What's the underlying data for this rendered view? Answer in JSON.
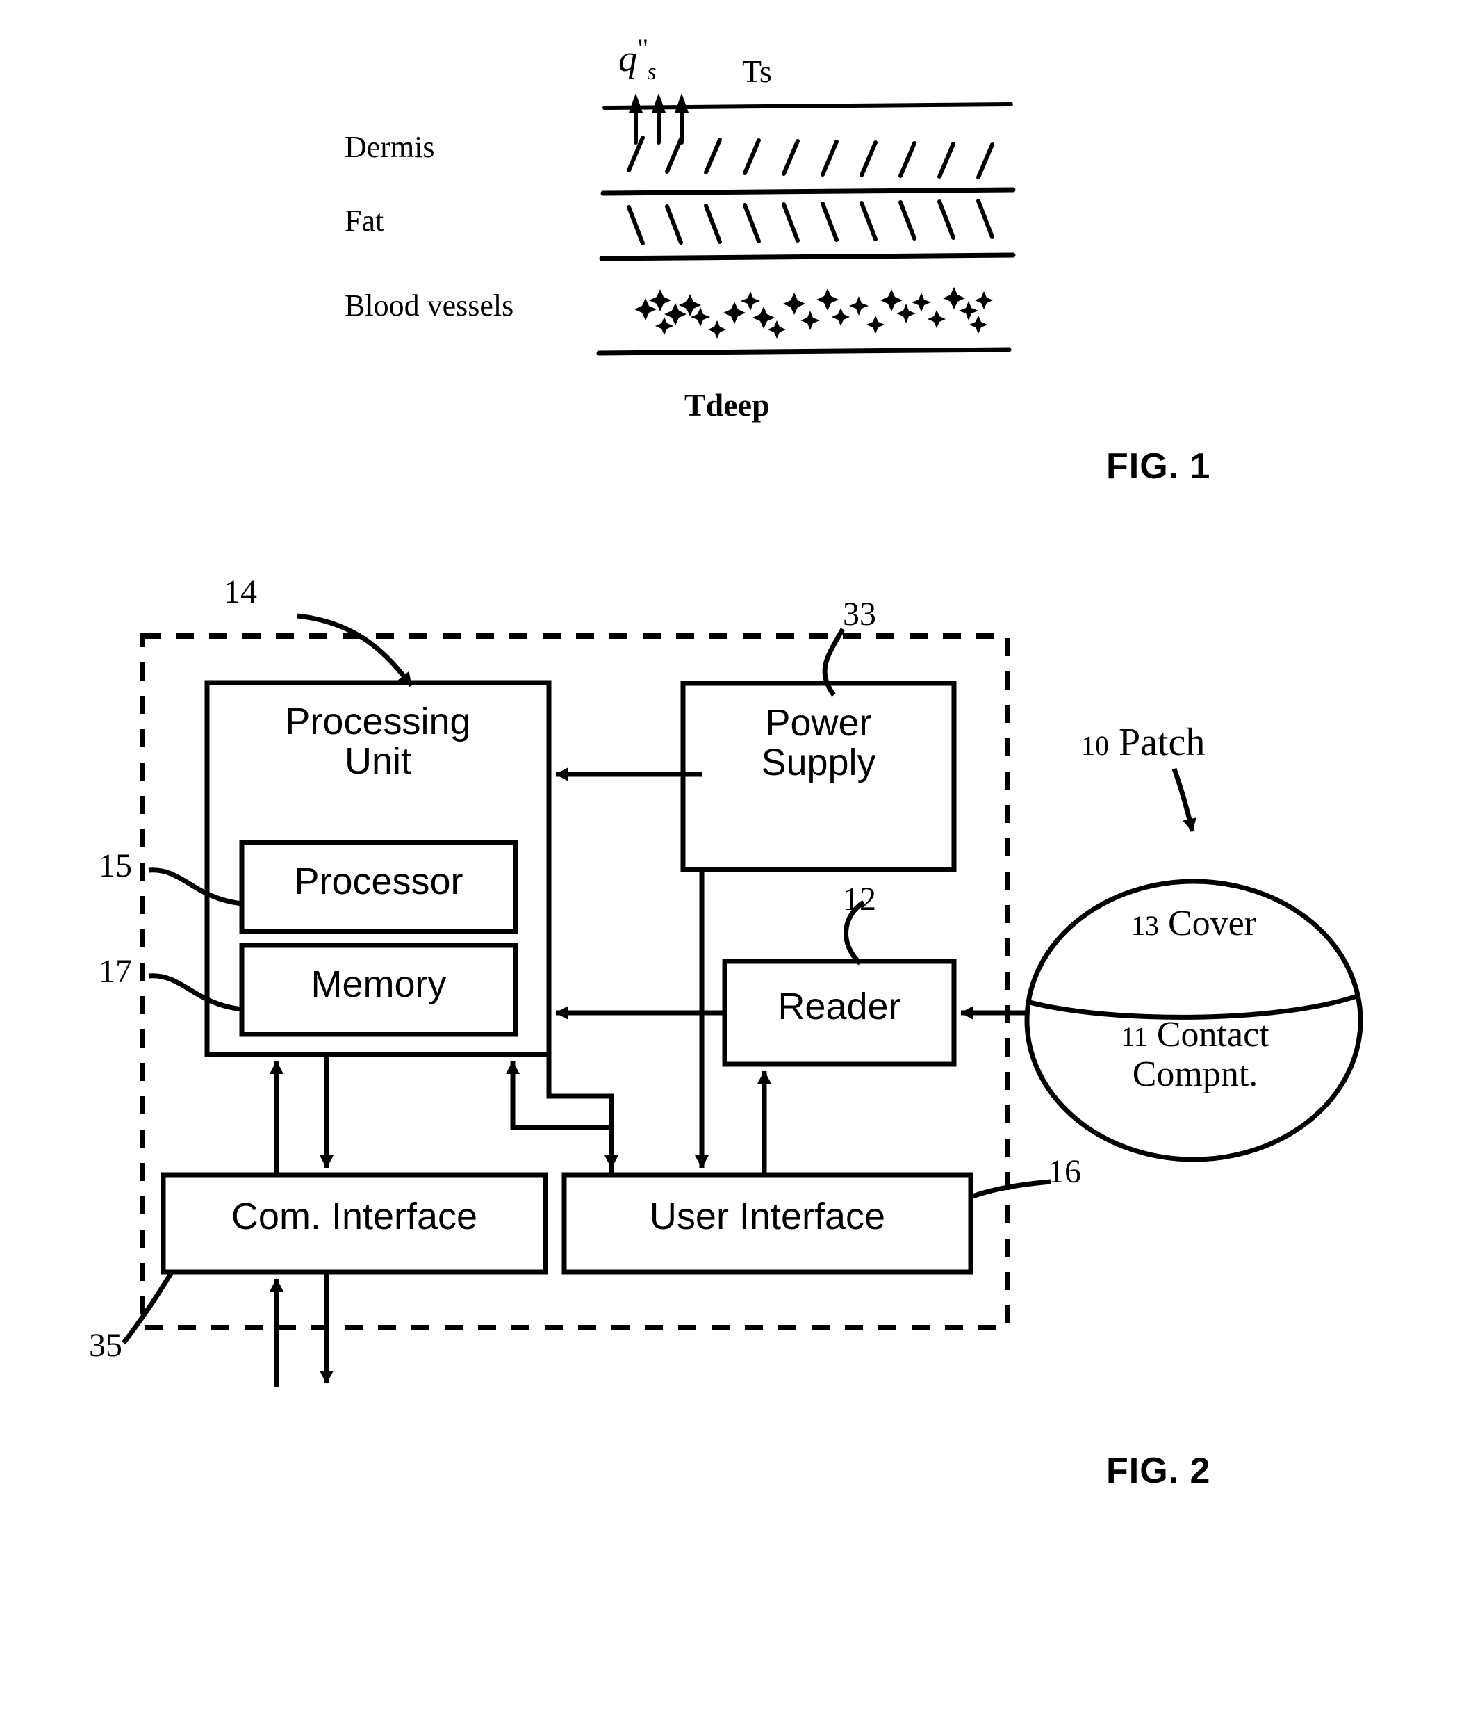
{
  "figure1": {
    "caption": "FIG. 1",
    "heat_flux_label": {
      "base": "q",
      "prime": "\"",
      "subscript": "s"
    },
    "surface_temp_label": "Ts",
    "deep_temp_label": "Tdeep",
    "layers": [
      {
        "name": "Dermis",
        "hatch": "forward-slash"
      },
      {
        "name": "Fat",
        "hatch": "back-slash"
      },
      {
        "name": "Blood vessels",
        "hatch": "speckles"
      }
    ],
    "arrow_count": 3
  },
  "figure2": {
    "caption": "FIG. 2",
    "enclosure_ref": "35",
    "blocks": [
      {
        "id": "processing-unit",
        "label": "Processing\nUnit",
        "ref": "14"
      },
      {
        "id": "processor",
        "label": "Processor",
        "ref": "15"
      },
      {
        "id": "memory",
        "label": "Memory",
        "ref": "17"
      },
      {
        "id": "power-supply",
        "label": "Power\nSupply",
        "ref": "33"
      },
      {
        "id": "reader",
        "label": "Reader",
        "ref": "12"
      },
      {
        "id": "com-interface",
        "label": "Com. Interface",
        "ref": "35"
      },
      {
        "id": "user-interface",
        "label": "User Interface",
        "ref": "16"
      }
    ],
    "patch": {
      "title_ref": "10",
      "title": "Patch",
      "cover_ref": "13",
      "cover_label": "Cover",
      "contact_ref": "11",
      "contact_label": "Contact\nCompnt."
    },
    "refs": {
      "r14": "14",
      "r15": "15",
      "r17": "17",
      "r33": "33",
      "r12": "12",
      "r16": "16",
      "r35": "35",
      "r10": "10",
      "r13": "13",
      "r11": "11"
    }
  },
  "colors": {
    "ink": "#000000",
    "paper": "#ffffff"
  }
}
